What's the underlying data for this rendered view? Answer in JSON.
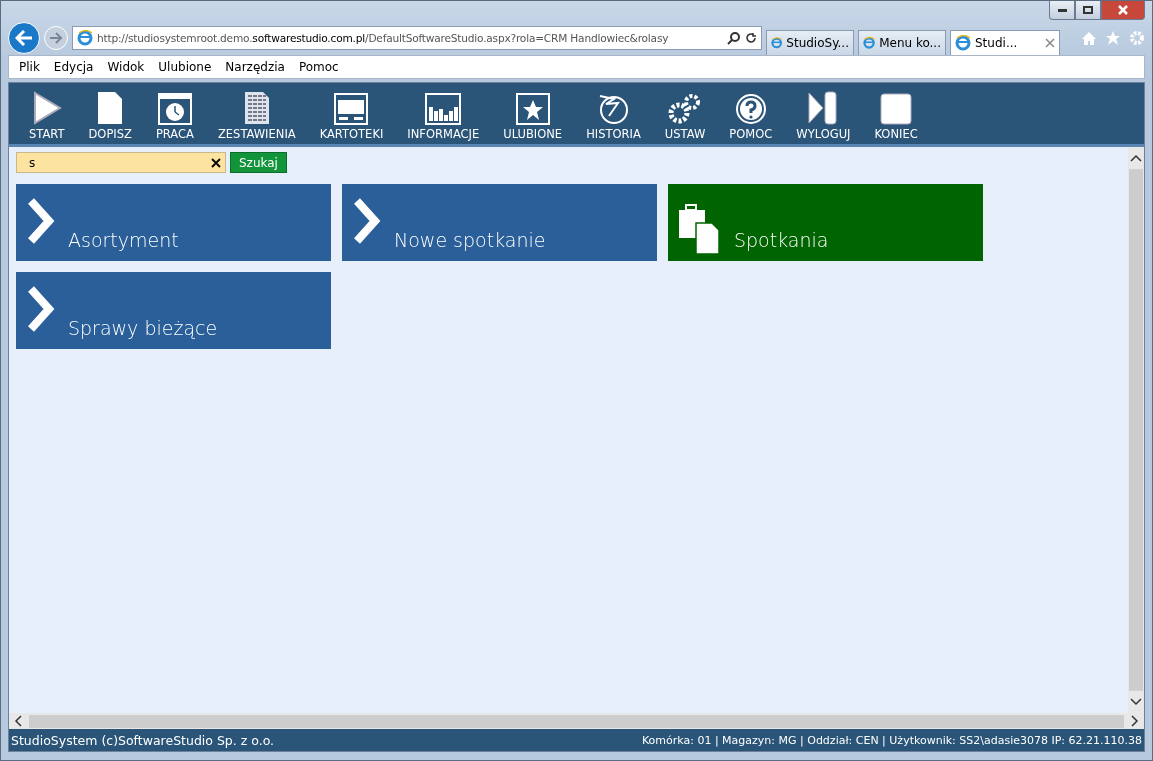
{
  "browser": {
    "address_prefix": "http://studiosystemroot.demo.",
    "address_host": "softwarestudio.com.pl",
    "address_path": "/DefaultSoftwareStudio.aspx?rola=CRM Handlowiec&rolasy",
    "tabs": [
      {
        "label": "StudioSy...",
        "selected": false
      },
      {
        "label": "Menu ko...",
        "selected": false
      },
      {
        "label": "Studi...",
        "selected": true
      }
    ],
    "menu": [
      "Plik",
      "Edycja",
      "Widok",
      "Ulubione",
      "Narzędzia",
      "Pomoc"
    ]
  },
  "toolbar": [
    "START",
    "DOPISZ",
    "PRACA",
    "ZESTAWIENIA",
    "KARTOTEKI",
    "INFORMACJE",
    "ULUBIONE",
    "HISTORIA",
    "USTAW",
    "POMOC",
    "WYLOGUJ",
    "KONIEC"
  ],
  "search": {
    "value": "s",
    "button": "Szukaj"
  },
  "tiles": [
    {
      "label": "Asortyment",
      "kind": "link",
      "color": "#2a5f99"
    },
    {
      "label": "Nowe spotkanie",
      "kind": "link",
      "color": "#2a5f99"
    },
    {
      "label": "Spotkania",
      "kind": "folder",
      "color": "#006400"
    },
    {
      "label": "Sprawy bieżące",
      "kind": "link",
      "color": "#2a5f99"
    }
  ],
  "status_bar": {
    "left": "StudioSystem (c)SoftwareStudio Sp. z o.o.",
    "right": "Komórka: 01 | Magazyn: MG | Oddział: CEN | Użytkownik: SS2\\adasie3078 IP: 62.21.110.38"
  }
}
